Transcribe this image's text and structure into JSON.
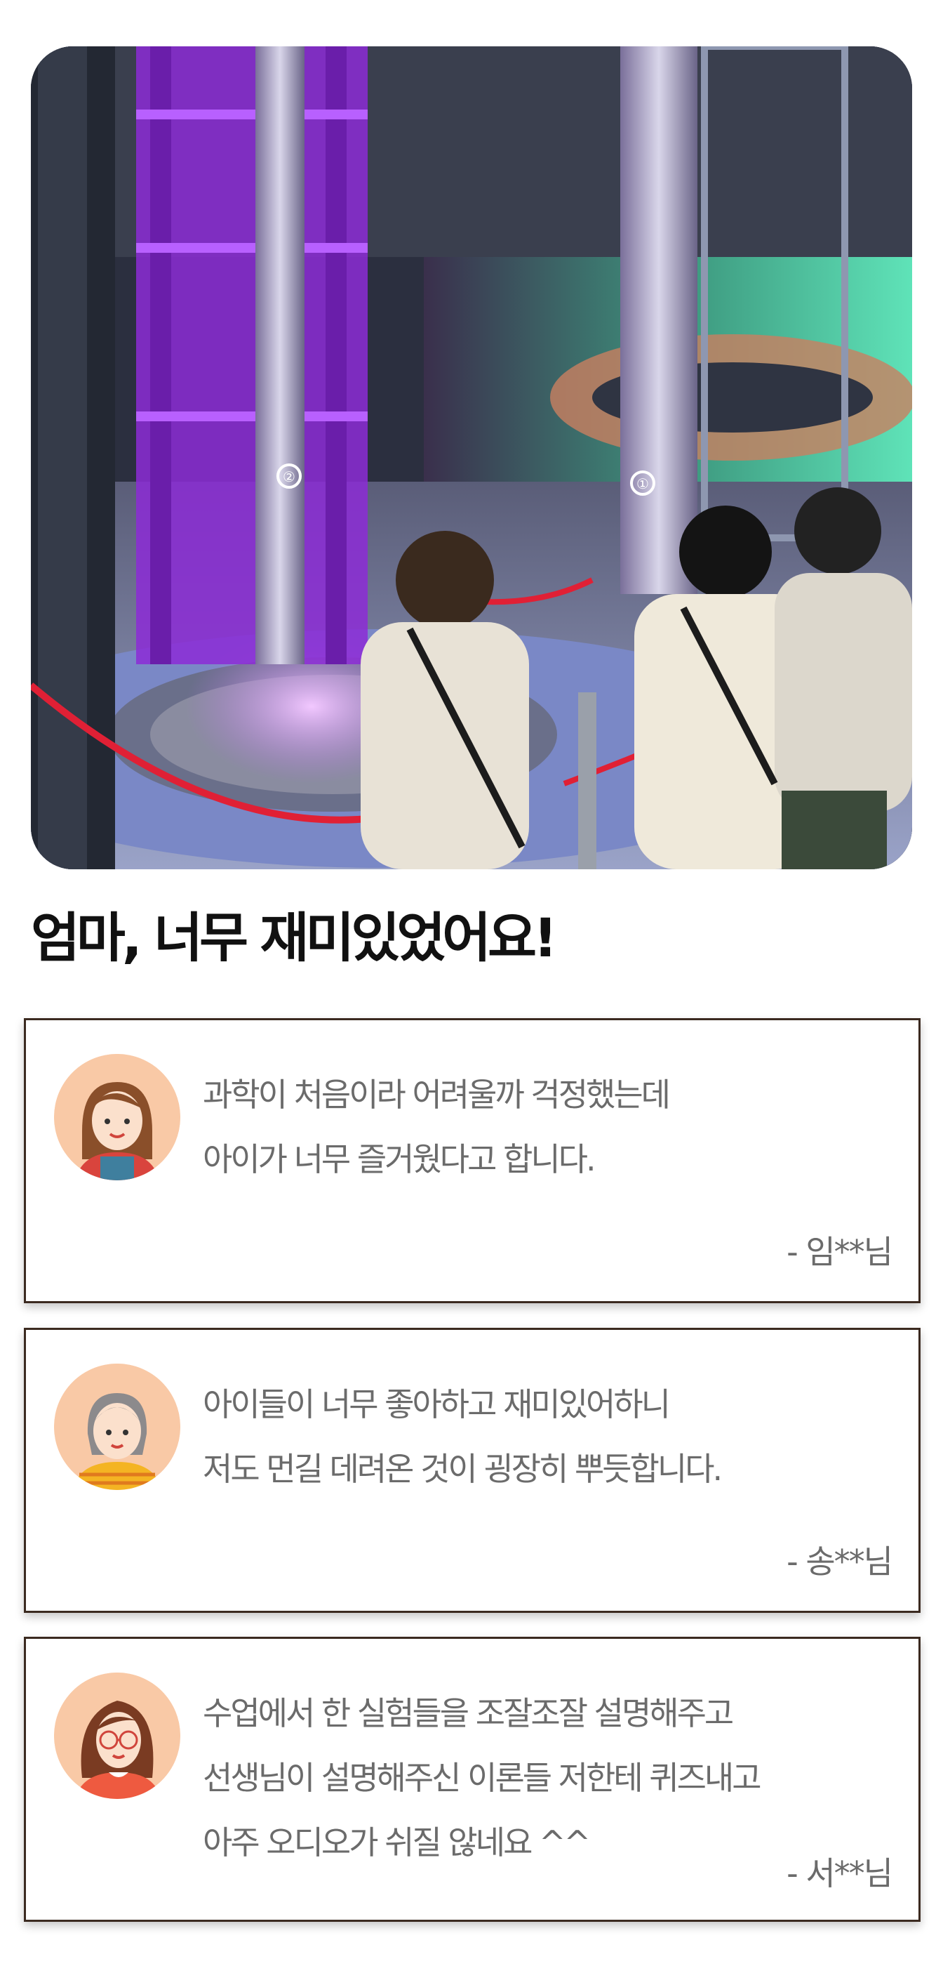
{
  "hero": {
    "image": "photo-children-science-museum-vortex-exhibit",
    "pillar_labels": [
      "②",
      "①"
    ]
  },
  "headline": "엄마, 너무 재미있었어요!",
  "reviews": [
    {
      "avatar": "woman-brown-hair-avatar",
      "lines": [
        "과학이 처음이라 어려울까 걱정했는데",
        "아이가 너무 즐거웠다고 합니다."
      ],
      "author": "- 임**님"
    },
    {
      "avatar": "woman-gray-hair-yellow-shirt-avatar",
      "lines": [
        "아이들이 너무 좋아하고 재미있어하니",
        "저도 먼길 데려온 것이 굉장히 뿌듯합니다."
      ],
      "author": "- 송**님"
    },
    {
      "avatar": "woman-glasses-avatar",
      "lines": [
        "수업에서 한 실험들을 조잘조잘 설명해주고",
        "선생님이 설명해주신 이론들 저한테 퀴즈내고",
        "아주 오디오가 쉬질 않네요 ^^"
      ],
      "author": "- 서**님"
    }
  ],
  "colors": {
    "card_border": "#3b2a20",
    "text_gray": "#6b6b6b",
    "avatar_bg": "#f9c9a6"
  }
}
